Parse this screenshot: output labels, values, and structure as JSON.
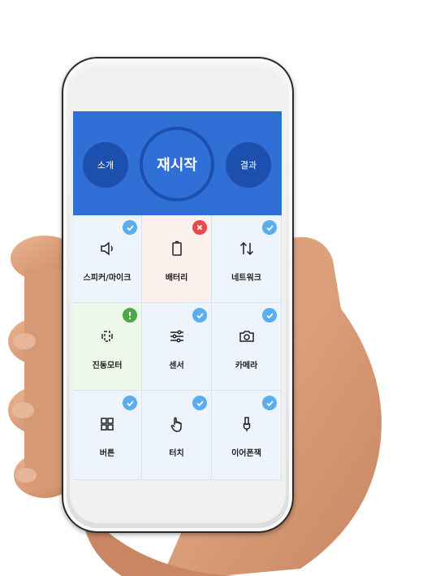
{
  "header": {
    "left_button_label": "소개",
    "center_button_label": "재시작",
    "right_button_label": "결과"
  },
  "tests": [
    {
      "label": "스피커/마이크",
      "icon": "speaker-icon",
      "status": "pass"
    },
    {
      "label": "배터리",
      "icon": "battery-icon",
      "status": "fail"
    },
    {
      "label": "네트워크",
      "icon": "up-down-arrows-icon",
      "status": "pass"
    },
    {
      "label": "진동모터",
      "icon": "vibration-icon",
      "status": "warning"
    },
    {
      "label": "센서",
      "icon": "sliders-icon",
      "status": "pass"
    },
    {
      "label": "카메라",
      "icon": "camera-icon",
      "status": "pass"
    },
    {
      "label": "버튼",
      "icon": "grid-icon",
      "status": "pass"
    },
    {
      "label": "터치",
      "icon": "touch-hand-icon",
      "status": "pass"
    },
    {
      "label": "이어폰잭",
      "icon": "earphone-jack-icon",
      "status": "pass"
    }
  ],
  "colors": {
    "header_bg": "#2f6fd6",
    "button_dark": "#1d4fae",
    "pass": "#5aaef0",
    "fail": "#e84b4b",
    "warning": "#4aa84a",
    "cell_default": "#eef4fb",
    "cell_fail": "#fdf1ee",
    "cell_warning": "#eef8ea"
  }
}
